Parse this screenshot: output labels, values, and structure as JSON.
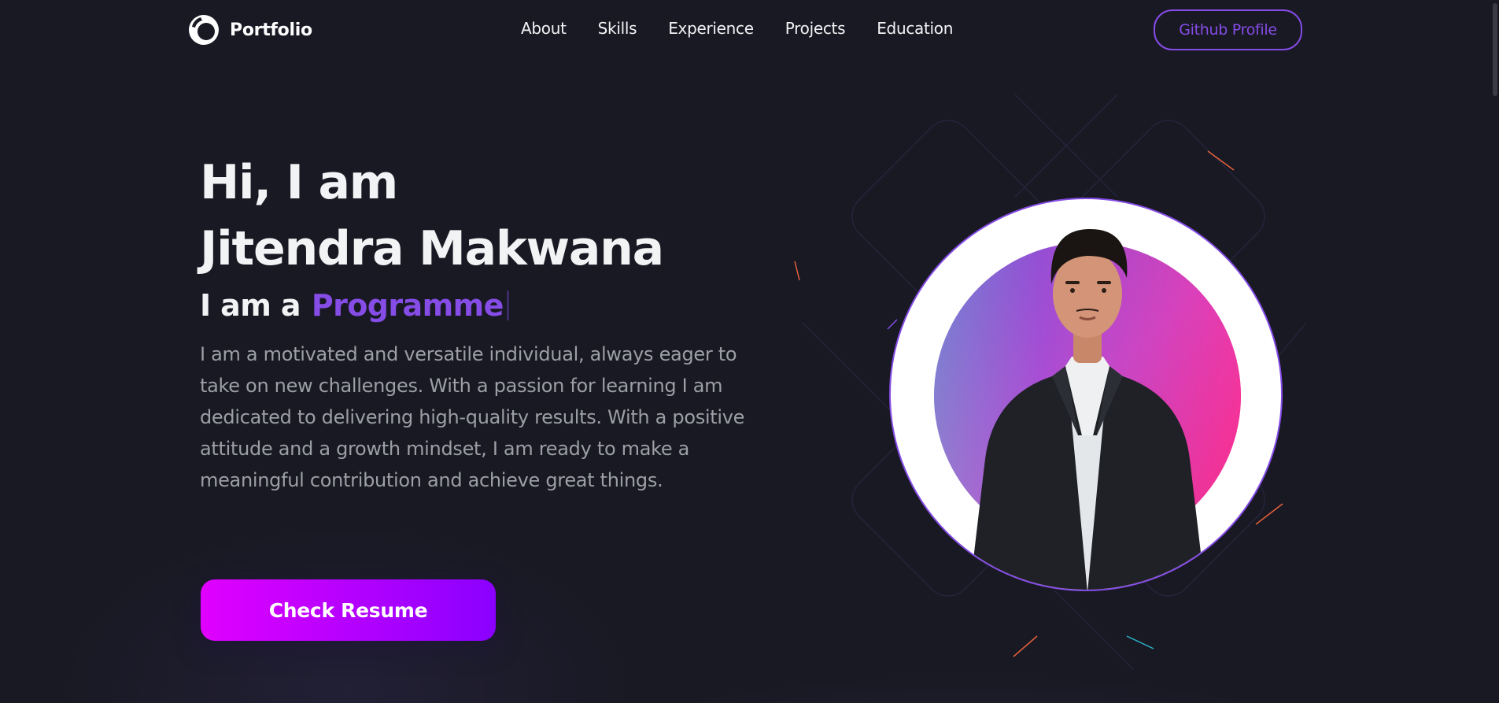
{
  "navbar": {
    "logo_text": "Portfolio",
    "links": [
      "About",
      "Skills",
      "Experience",
      "Projects",
      "Education"
    ],
    "github_label": "Github Profile"
  },
  "hero": {
    "greeting": "Hi, I am",
    "name": "Jitendra Makwana",
    "role_prefix": "I am a",
    "role_typed": "Programme",
    "description": "I am a motivated and versatile individual, always eager to take on new challenges. With a passion for learning I am dedicated to delivering high-quality results. With a positive attitude and a growth mindset, I am ready to make a meaningful contribution and achieve great things.",
    "resume_label": "Check Resume"
  },
  "colors": {
    "background": "#191924",
    "accent": "#854ce6",
    "text_primary": "#f2f3f4",
    "text_secondary": "#9c9fa5",
    "button_gradient_start": "#e100ff",
    "button_gradient_end": "#8a00ff"
  },
  "icons": {
    "logo": "portfolio-logo-icon"
  }
}
